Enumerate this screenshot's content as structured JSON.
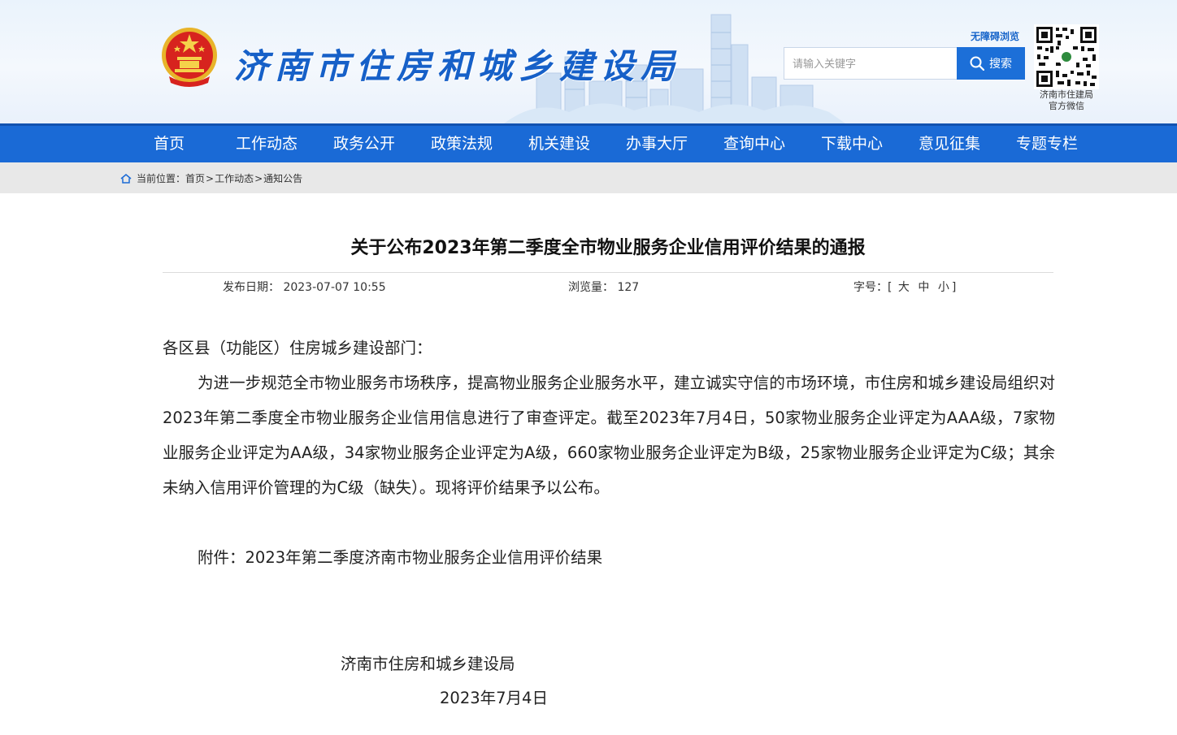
{
  "header": {
    "site_title": "济南市住房和城乡建设局",
    "accessibility_link": "无障碍浏览",
    "search": {
      "placeholder": "请输入关键字",
      "button_label": "搜索"
    },
    "qr_caption_line1": "济南市住建局",
    "qr_caption_line2": "官方微信",
    "brand_color": "#1a6ad6"
  },
  "nav": {
    "items": [
      "首页",
      "工作动态",
      "政务公开",
      "政策法规",
      "机关建设",
      "办事大厅",
      "查询中心",
      "下载中心",
      "意见征集",
      "专题专栏"
    ]
  },
  "breadcrumb": {
    "prefix": "当前位置：",
    "items": [
      "首页",
      "工作动态",
      "通知公告"
    ],
    "separator": ">"
  },
  "article": {
    "title": "关于公布2023年第二季度全市物业服务企业信用评价结果的通报",
    "publish_label": "发布日期：",
    "publish_date": "2023-07-07 10:55",
    "views_label": "浏览量：",
    "views": "127",
    "font_size_label": "字号：",
    "font_size_open": "[",
    "font_size_large": "大",
    "font_size_medium": "中",
    "font_size_small": "小",
    "font_size_close": "]",
    "salutation": "各区县（功能区）住房城乡建设部门：",
    "body": "为进一步规范全市物业服务市场秩序，提高物业服务企业服务水平，建立诚实守信的市场环境，市住房和城乡建设局组织对2023年第二季度全市物业服务企业信用信息进行了审查评定。截至2023年7月4日，50家物业服务企业评定为AAA级，7家物业服务企业评定为AA级，34家物业服务企业评定为A级，660家物业服务企业评定为B级，25家物业服务企业评定为C级；其余未纳入信用评价管理的为C级（缺失）。现将评价结果予以公布。",
    "attachment_label": "附件：",
    "attachment_name": "2023年第二季度济南市物业服务企业信用评价结果",
    "signature": "济南市住房和城乡建设局",
    "sign_date": "2023年7月4日"
  }
}
